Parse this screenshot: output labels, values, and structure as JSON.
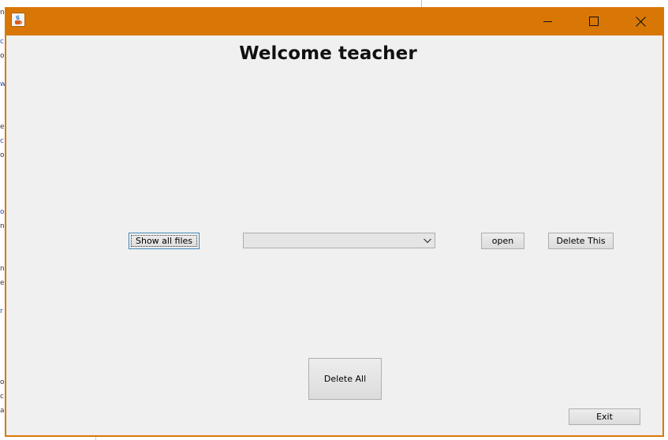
{
  "window": {
    "title": "",
    "title_bar_color": "#d97706"
  },
  "title_bar_buttons": {
    "minimize_icon": "minimize-icon",
    "maximize_icon": "maximize-icon",
    "close_icon": "close-icon"
  },
  "app_icon": "java-cup-icon",
  "main": {
    "heading": "Welcome teacher",
    "show_all_files_label": "Show all files",
    "file_select_value": "",
    "file_select_icon": "chevron-down-icon",
    "open_label": "open",
    "delete_this_label": "Delete This",
    "delete_all_label": "Delete All",
    "exit_label": "Exit"
  },
  "background_text": {
    "left_glyphs": [
      "n",
      "c",
      "o",
      "w",
      "e",
      "c",
      "o",
      "o",
      "n",
      "n",
      "e",
      "r",
      "o",
      "c",
      "a"
    ]
  }
}
